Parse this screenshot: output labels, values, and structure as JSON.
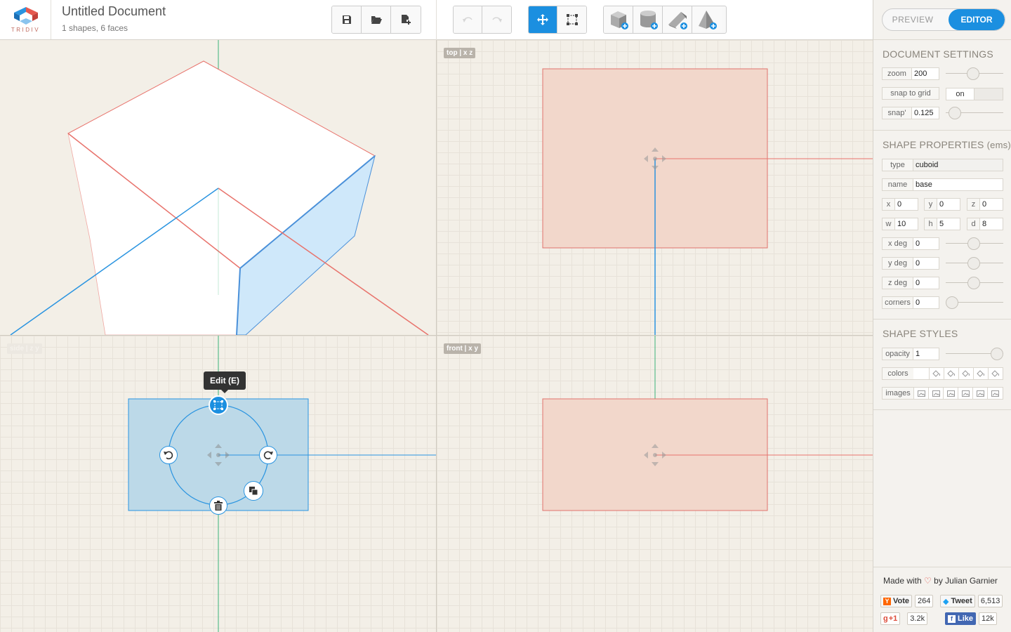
{
  "app": {
    "logo_text": "TRIDIV",
    "doc_title": "Untitled Document",
    "doc_subtitle": "1 shapes, 6 faces"
  },
  "toolbar": {
    "file_buttons": [
      "save-icon",
      "open-folder-icon",
      "new-document-icon"
    ],
    "history_buttons": [
      "undo-icon",
      "redo-icon"
    ],
    "mode_buttons": [
      "move-icon",
      "select-icon"
    ],
    "shape_buttons": [
      "add-cuboid-icon",
      "add-cylinder-icon",
      "add-prism-icon",
      "add-pyramid-icon"
    ],
    "colors": {
      "accent": "#1b8fe0",
      "shape_fill": "#f2d7cb",
      "shape_stroke": "#e0736c"
    }
  },
  "viewports": {
    "top_label": "top | x z",
    "side_label": "side | z y",
    "front_label": "front | x y",
    "edit_tooltip": "Edit (E)"
  },
  "sidebar": {
    "mode": {
      "preview": "PREVIEW",
      "editor": "EDITOR"
    },
    "document_settings": {
      "title": "DOCUMENT SETTINGS",
      "zoom_label": "zoom",
      "zoom_value": "200",
      "snap_label": "snap to grid",
      "snap_value": "on",
      "snapp_label": "snap'",
      "snapp_value": "0.125"
    },
    "shape_properties": {
      "title": "SHAPE PROPERTIES",
      "unit": "(ems)",
      "type_label": "type",
      "type_value": "cuboid",
      "name_label": "name",
      "name_value": "base",
      "x_label": "x",
      "x_value": "0",
      "y_label": "y",
      "y_value": "0",
      "z_label": "z",
      "z_value": "0",
      "w_label": "w",
      "w_value": "10",
      "h_label": "h",
      "h_value": "5",
      "d_label": "d",
      "d_value": "8",
      "xdeg_label": "x deg",
      "xdeg_value": "0",
      "ydeg_label": "y deg",
      "ydeg_value": "0",
      "zdeg_label": "z deg",
      "zdeg_value": "0",
      "corners_label": "corners",
      "corners_value": "0"
    },
    "shape_styles": {
      "title": "SHAPE STYLES",
      "opacity_label": "opacity",
      "opacity_value": "1",
      "colors_label": "colors",
      "images_label": "images"
    },
    "credits": {
      "made_with": "Made with",
      "by": "by Julian Garnier",
      "vote": "Vote",
      "vote_count": "264",
      "tweet": "Tweet",
      "tweet_count": "6,513",
      "gplus": "+1",
      "gplus_count": "3.2k",
      "like": "Like",
      "like_count": "12k"
    }
  }
}
